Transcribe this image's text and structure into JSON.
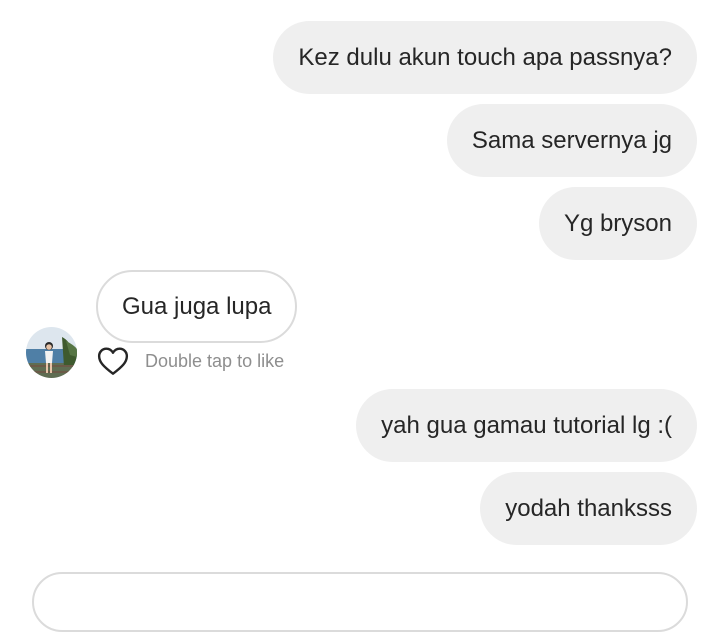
{
  "messages": [
    {
      "direction": "outgoing",
      "text": "Kez dulu akun touch apa passnya?"
    },
    {
      "direction": "outgoing",
      "text": "Sama servernya jg"
    },
    {
      "direction": "outgoing",
      "text": "Yg bryson"
    },
    {
      "direction": "incoming",
      "text": "Gua juga lupa"
    },
    {
      "direction": "outgoing",
      "text": "yah gua gamau tutorial lg :("
    },
    {
      "direction": "outgoing",
      "text": "yodah thanksss"
    }
  ],
  "like_hint": "Double tap to like",
  "icons": {
    "like": "heart-outline-icon",
    "avatar": "user-avatar"
  },
  "colors": {
    "outgoing_bubble": "#efefef",
    "incoming_border": "#dbdbdb",
    "text": "#262626",
    "hint_text": "#8e8e8e"
  }
}
